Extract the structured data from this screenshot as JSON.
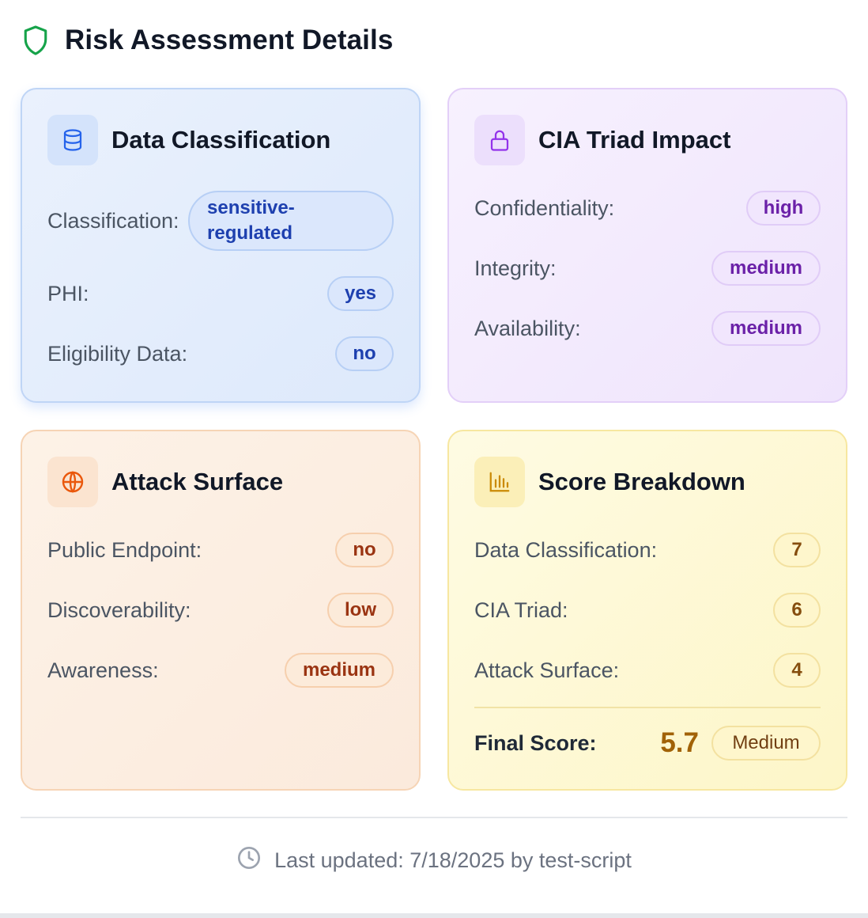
{
  "header": {
    "title": "Risk Assessment Details",
    "icon": "shield-icon"
  },
  "cards": {
    "data_classification": {
      "title": "Data Classification",
      "icon": "database-icon",
      "rows": [
        {
          "label": "Classification:",
          "value": "sensitive-regulated"
        },
        {
          "label": "PHI:",
          "value": "yes"
        },
        {
          "label": "Eligibility Data:",
          "value": "no"
        }
      ]
    },
    "cia_triad": {
      "title": "CIA Triad Impact",
      "icon": "lock-icon",
      "rows": [
        {
          "label": "Confidentiality:",
          "value": "high"
        },
        {
          "label": "Integrity:",
          "value": "medium"
        },
        {
          "label": "Availability:",
          "value": "medium"
        }
      ]
    },
    "attack_surface": {
      "title": "Attack Surface",
      "icon": "globe-icon",
      "rows": [
        {
          "label": "Public Endpoint:",
          "value": "no"
        },
        {
          "label": "Discoverability:",
          "value": "low"
        },
        {
          "label": "Awareness:",
          "value": "medium"
        }
      ]
    },
    "score_breakdown": {
      "title": "Score Breakdown",
      "icon": "bar-chart-icon",
      "rows": [
        {
          "label": "Data Classification:",
          "value": "7"
        },
        {
          "label": "CIA Triad:",
          "value": "6"
        },
        {
          "label": "Attack Surface:",
          "value": "4"
        }
      ],
      "final": {
        "label": "Final Score:",
        "score": "5.7",
        "level": "Medium"
      }
    }
  },
  "footer": {
    "text": "Last updated: 7/18/2025 by test-script",
    "icon": "clock-icon"
  },
  "colors": {
    "blue_accent": "#1e40af",
    "purple_accent": "#6b21a8",
    "orange_accent": "#9a3412",
    "yellow_accent": "#a16207",
    "shield_green": "#16a34a"
  }
}
